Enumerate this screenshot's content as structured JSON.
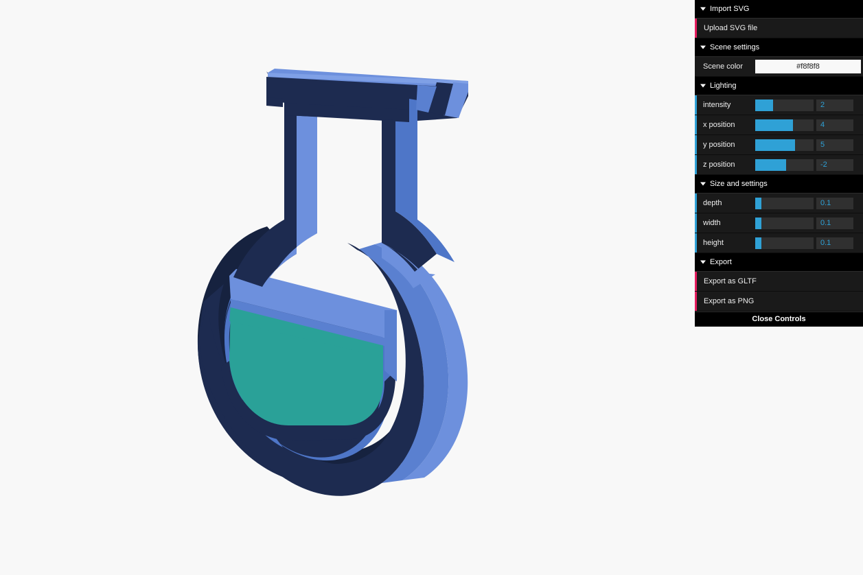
{
  "scene": {
    "background_color": "#f8f8f8",
    "model_name": "flask-3d-extrusion",
    "colors": {
      "outline_dark": "#1d2b50",
      "outline_dark_shade": "#16223f",
      "body_blue": "#4e76c8",
      "body_blue_light": "#6d90dd",
      "body_blue_mid": "#5a80d0",
      "liquid_teal": "#2aa198",
      "liquid_teal_dark": "#1f8d85"
    }
  },
  "gui": {
    "folders": [
      {
        "name": "import-svg",
        "title": "Import SVG",
        "rows": [
          {
            "type": "action",
            "name": "upload-svg-file",
            "label": "Upload SVG file",
            "stripe": "pink"
          }
        ]
      },
      {
        "name": "scene-settings",
        "title": "Scene settings",
        "rows": [
          {
            "type": "color",
            "name": "scene-color",
            "label": "Scene color",
            "value": "#f8f8f8",
            "stripe": "none"
          }
        ]
      },
      {
        "name": "lighting",
        "title": "Lighting",
        "rows": [
          {
            "type": "slider",
            "name": "intensity",
            "label": "intensity",
            "value": "2",
            "fill_pct": 30,
            "stripe": "blue"
          },
          {
            "type": "slider",
            "name": "x-position",
            "label": "x position",
            "value": "4",
            "fill_pct": 65,
            "stripe": "blue"
          },
          {
            "type": "slider",
            "name": "y-position",
            "label": "y position",
            "value": "5",
            "fill_pct": 68,
            "stripe": "blue"
          },
          {
            "type": "slider",
            "name": "z-position",
            "label": "z position",
            "value": "-2",
            "fill_pct": 53,
            "stripe": "blue"
          }
        ]
      },
      {
        "name": "size-and-settings",
        "title": "Size and settings",
        "rows": [
          {
            "type": "slider",
            "name": "depth",
            "label": "depth",
            "value": "0.1",
            "fill_pct": 10,
            "stripe": "blue"
          },
          {
            "type": "slider",
            "name": "width",
            "label": "width",
            "value": "0.1",
            "fill_pct": 10,
            "stripe": "blue"
          },
          {
            "type": "slider",
            "name": "height",
            "label": "height",
            "value": "0.1",
            "fill_pct": 10,
            "stripe": "blue"
          }
        ]
      },
      {
        "name": "export",
        "title": "Export",
        "rows": [
          {
            "type": "action",
            "name": "export-as-gltf",
            "label": "Export as GLTF",
            "stripe": "pink"
          },
          {
            "type": "action",
            "name": "export-as-png",
            "label": "Export as PNG",
            "stripe": "pink"
          }
        ]
      }
    ],
    "close_label": "Close Controls"
  }
}
